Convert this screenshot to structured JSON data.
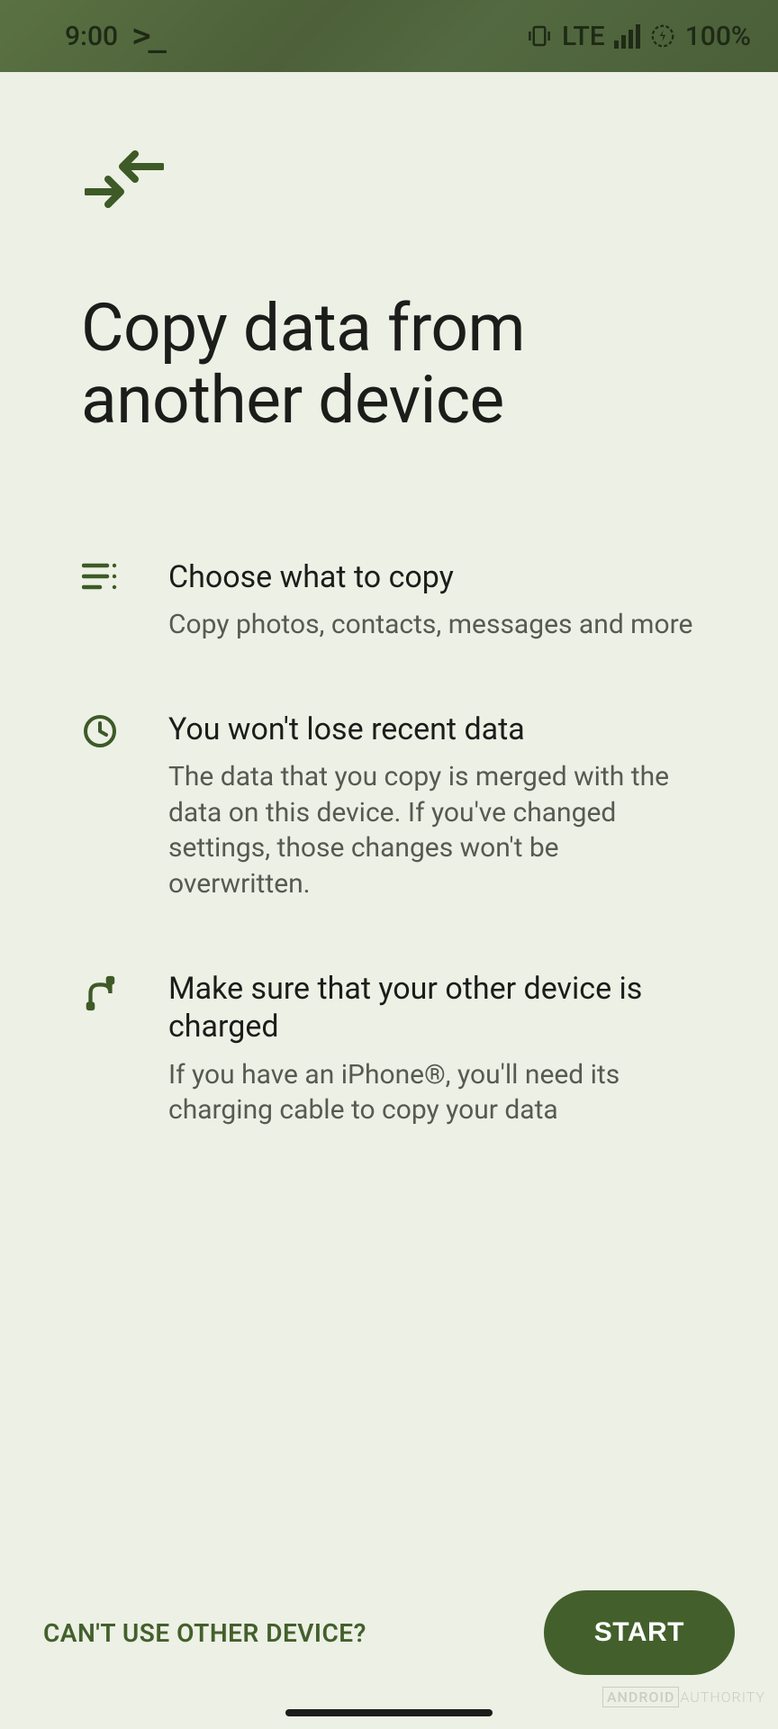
{
  "status": {
    "time": "9:00",
    "network": "LTE",
    "battery": "100%"
  },
  "page": {
    "title": "Copy data from another device"
  },
  "items": [
    {
      "title": "Choose what to copy",
      "desc": "Copy photos, contacts, messages and more"
    },
    {
      "title": "You won't lose recent data",
      "desc": "The data that you copy is merged with the data on this device. If you've changed settings, those changes won't be overwritten."
    },
    {
      "title": "Make sure that your other device is charged",
      "desc": "If you have an iPhone®, you'll need its charging cable to copy your data"
    }
  ],
  "footer": {
    "skip": "CAN'T USE OTHER DEVICE?",
    "start": "START"
  },
  "watermark": {
    "a": "ANDROID",
    "b": "AUTHORITY"
  }
}
